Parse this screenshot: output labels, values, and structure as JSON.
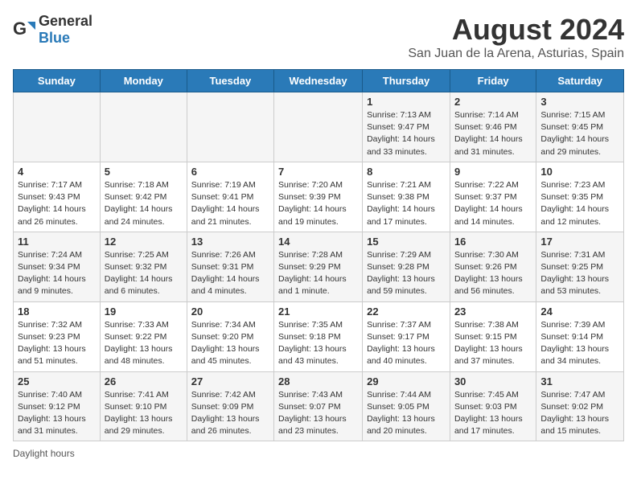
{
  "header": {
    "logo_general": "General",
    "logo_blue": "Blue",
    "title": "August 2024",
    "subtitle": "San Juan de la Arena, Asturias, Spain"
  },
  "days_of_week": [
    "Sunday",
    "Monday",
    "Tuesday",
    "Wednesday",
    "Thursday",
    "Friday",
    "Saturday"
  ],
  "weeks": [
    [
      {
        "day": "",
        "info": ""
      },
      {
        "day": "",
        "info": ""
      },
      {
        "day": "",
        "info": ""
      },
      {
        "day": "",
        "info": ""
      },
      {
        "day": "1",
        "info": "Sunrise: 7:13 AM\nSunset: 9:47 PM\nDaylight: 14 hours\nand 33 minutes."
      },
      {
        "day": "2",
        "info": "Sunrise: 7:14 AM\nSunset: 9:46 PM\nDaylight: 14 hours\nand 31 minutes."
      },
      {
        "day": "3",
        "info": "Sunrise: 7:15 AM\nSunset: 9:45 PM\nDaylight: 14 hours\nand 29 minutes."
      }
    ],
    [
      {
        "day": "4",
        "info": "Sunrise: 7:17 AM\nSunset: 9:43 PM\nDaylight: 14 hours\nand 26 minutes."
      },
      {
        "day": "5",
        "info": "Sunrise: 7:18 AM\nSunset: 9:42 PM\nDaylight: 14 hours\nand 24 minutes."
      },
      {
        "day": "6",
        "info": "Sunrise: 7:19 AM\nSunset: 9:41 PM\nDaylight: 14 hours\nand 21 minutes."
      },
      {
        "day": "7",
        "info": "Sunrise: 7:20 AM\nSunset: 9:39 PM\nDaylight: 14 hours\nand 19 minutes."
      },
      {
        "day": "8",
        "info": "Sunrise: 7:21 AM\nSunset: 9:38 PM\nDaylight: 14 hours\nand 17 minutes."
      },
      {
        "day": "9",
        "info": "Sunrise: 7:22 AM\nSunset: 9:37 PM\nDaylight: 14 hours\nand 14 minutes."
      },
      {
        "day": "10",
        "info": "Sunrise: 7:23 AM\nSunset: 9:35 PM\nDaylight: 14 hours\nand 12 minutes."
      }
    ],
    [
      {
        "day": "11",
        "info": "Sunrise: 7:24 AM\nSunset: 9:34 PM\nDaylight: 14 hours\nand 9 minutes."
      },
      {
        "day": "12",
        "info": "Sunrise: 7:25 AM\nSunset: 9:32 PM\nDaylight: 14 hours\nand 6 minutes."
      },
      {
        "day": "13",
        "info": "Sunrise: 7:26 AM\nSunset: 9:31 PM\nDaylight: 14 hours\nand 4 minutes."
      },
      {
        "day": "14",
        "info": "Sunrise: 7:28 AM\nSunset: 9:29 PM\nDaylight: 14 hours\nand 1 minute."
      },
      {
        "day": "15",
        "info": "Sunrise: 7:29 AM\nSunset: 9:28 PM\nDaylight: 13 hours\nand 59 minutes."
      },
      {
        "day": "16",
        "info": "Sunrise: 7:30 AM\nSunset: 9:26 PM\nDaylight: 13 hours\nand 56 minutes."
      },
      {
        "day": "17",
        "info": "Sunrise: 7:31 AM\nSunset: 9:25 PM\nDaylight: 13 hours\nand 53 minutes."
      }
    ],
    [
      {
        "day": "18",
        "info": "Sunrise: 7:32 AM\nSunset: 9:23 PM\nDaylight: 13 hours\nand 51 minutes."
      },
      {
        "day": "19",
        "info": "Sunrise: 7:33 AM\nSunset: 9:22 PM\nDaylight: 13 hours\nand 48 minutes."
      },
      {
        "day": "20",
        "info": "Sunrise: 7:34 AM\nSunset: 9:20 PM\nDaylight: 13 hours\nand 45 minutes."
      },
      {
        "day": "21",
        "info": "Sunrise: 7:35 AM\nSunset: 9:18 PM\nDaylight: 13 hours\nand 43 minutes."
      },
      {
        "day": "22",
        "info": "Sunrise: 7:37 AM\nSunset: 9:17 PM\nDaylight: 13 hours\nand 40 minutes."
      },
      {
        "day": "23",
        "info": "Sunrise: 7:38 AM\nSunset: 9:15 PM\nDaylight: 13 hours\nand 37 minutes."
      },
      {
        "day": "24",
        "info": "Sunrise: 7:39 AM\nSunset: 9:14 PM\nDaylight: 13 hours\nand 34 minutes."
      }
    ],
    [
      {
        "day": "25",
        "info": "Sunrise: 7:40 AM\nSunset: 9:12 PM\nDaylight: 13 hours\nand 31 minutes."
      },
      {
        "day": "26",
        "info": "Sunrise: 7:41 AM\nSunset: 9:10 PM\nDaylight: 13 hours\nand 29 minutes."
      },
      {
        "day": "27",
        "info": "Sunrise: 7:42 AM\nSunset: 9:09 PM\nDaylight: 13 hours\nand 26 minutes."
      },
      {
        "day": "28",
        "info": "Sunrise: 7:43 AM\nSunset: 9:07 PM\nDaylight: 13 hours\nand 23 minutes."
      },
      {
        "day": "29",
        "info": "Sunrise: 7:44 AM\nSunset: 9:05 PM\nDaylight: 13 hours\nand 20 minutes."
      },
      {
        "day": "30",
        "info": "Sunrise: 7:45 AM\nSunset: 9:03 PM\nDaylight: 13 hours\nand 17 minutes."
      },
      {
        "day": "31",
        "info": "Sunrise: 7:47 AM\nSunset: 9:02 PM\nDaylight: 13 hours\nand 15 minutes."
      }
    ]
  ],
  "footer": {
    "note": "Daylight hours"
  }
}
